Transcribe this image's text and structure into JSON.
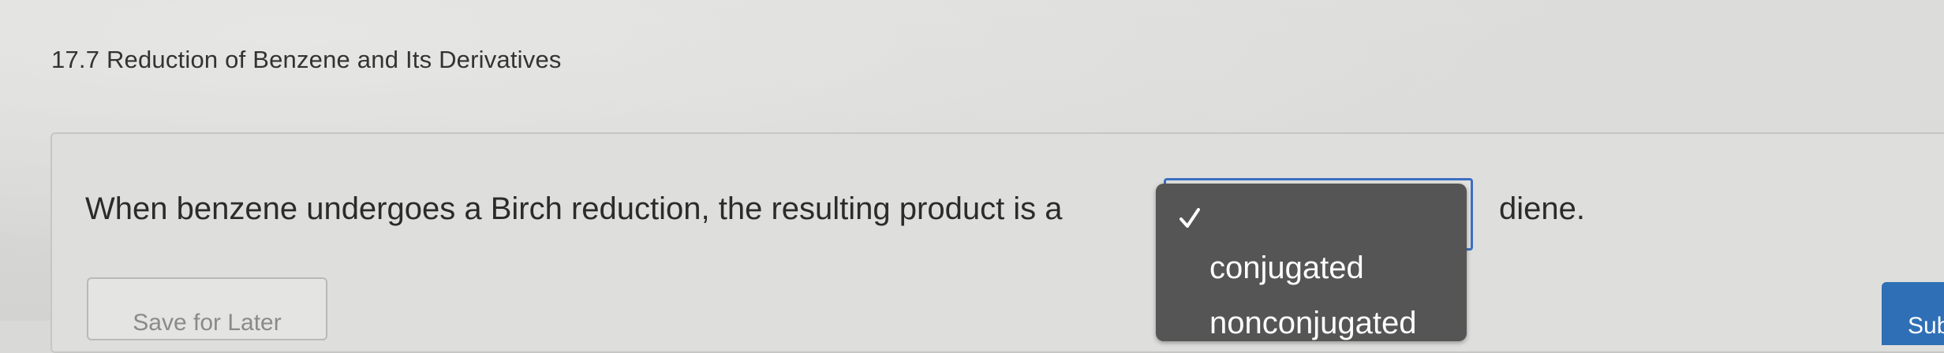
{
  "header": {
    "section_title": "17.7 Reduction of Benzene and Its Derivatives"
  },
  "question": {
    "prompt_before": "When benzene undergoes a Birch reduction, the resulting product is a",
    "prompt_after": "diene.",
    "dropdown": {
      "selected_value": "",
      "options": [
        "conjugated",
        "nonconjugated"
      ],
      "option_1": "conjugated",
      "option_2": "nonconjugated"
    }
  },
  "actions": {
    "save_label": "Save for Later",
    "submit_label": "Submit"
  },
  "colors": {
    "focus_outline": "#3c6fc2",
    "menu_background": "#555555",
    "submit_background": "#2f6fb5"
  },
  "icons": {
    "selected_marker": "check-icon"
  }
}
